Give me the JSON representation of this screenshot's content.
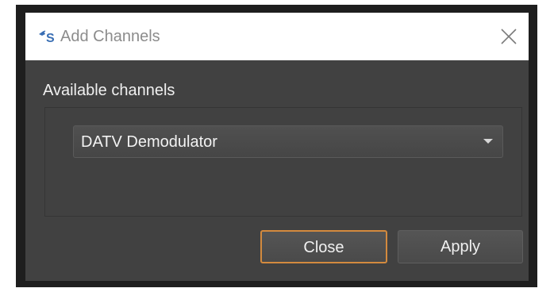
{
  "dialog": {
    "title": "Add Channels",
    "app_icon": "sdrangel-logo-icon",
    "close_icon": "close-icon"
  },
  "content": {
    "group_label": "Available channels",
    "channel_select": {
      "selected": "DATV Demodulator",
      "arrow_icon": "chevron-down-icon"
    }
  },
  "buttons": {
    "close_label": "Close",
    "apply_label": "Apply"
  },
  "colors": {
    "window_bg": "#414141",
    "titlebar_bg": "#ffffff",
    "focus_border": "#d38a3e",
    "logo_accent": "#3a6fb4"
  }
}
